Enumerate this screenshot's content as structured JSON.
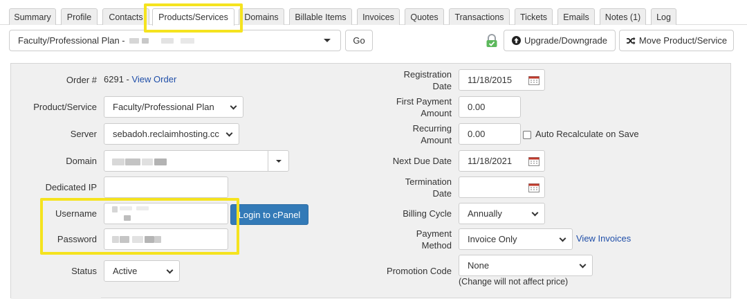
{
  "tabs": [
    {
      "label": "Summary",
      "active": false
    },
    {
      "label": "Profile",
      "active": false
    },
    {
      "label": "Contacts",
      "active": false
    },
    {
      "label": "Products/Services",
      "active": true
    },
    {
      "label": "Domains",
      "active": false
    },
    {
      "label": "Billable Items",
      "active": false
    },
    {
      "label": "Invoices",
      "active": false
    },
    {
      "label": "Quotes",
      "active": false
    },
    {
      "label": "Transactions",
      "active": false
    },
    {
      "label": "Tickets",
      "active": false
    },
    {
      "label": "Emails",
      "active": false
    },
    {
      "label": "Notes (1)",
      "active": false
    },
    {
      "label": "Log",
      "active": false
    }
  ],
  "toolbar": {
    "product_selected": "Faculty/Professional Plan -",
    "go_label": "Go",
    "upgrade_label": "Upgrade/Downgrade",
    "move_label": "Move Product/Service"
  },
  "left": {
    "order_label": "Order #",
    "order_number": "6291",
    "order_sep": " - ",
    "view_order_link": "View Order",
    "product_label": "Product/Service",
    "product_value": "Faculty/Professional Plan",
    "server_label": "Server",
    "server_value": "sebadoh.reclaimhosting.cc",
    "domain_label": "Domain",
    "dedicated_ip_label": "Dedicated IP",
    "dedicated_ip_value": "",
    "username_label": "Username",
    "login_cpanel_label": "Login to cPanel",
    "password_label": "Password",
    "status_label": "Status",
    "status_value": "Active"
  },
  "right": {
    "reg_date_label_1": "Registration",
    "reg_date_label_2": "Date",
    "reg_date_value": "11/18/2015",
    "first_payment_label_1": "First Payment",
    "first_payment_label_2": "Amount",
    "first_payment_value": "0.00",
    "recurring_label_1": "Recurring",
    "recurring_label_2": "Amount",
    "recurring_value": "0.00",
    "auto_recalc_label": "Auto Recalculate on Save",
    "next_due_label": "Next Due Date",
    "next_due_value": "11/18/2021",
    "termination_label_1": "Termination",
    "termination_label_2": "Date",
    "termination_value": "",
    "billing_cycle_label": "Billing Cycle",
    "billing_cycle_value": "Annually",
    "payment_method_label_1": "Payment",
    "payment_method_label_2": "Method",
    "payment_method_value": "Invoice Only",
    "view_invoices_link": "View Invoices",
    "promo_label": "Promotion Code",
    "promo_value": "None",
    "promo_note": "(Change will not affect price)"
  },
  "colors": {
    "highlight": "#f5e31f",
    "link": "#1f4ea8",
    "primary_button": "#337ab7",
    "lock_green": "#5cb85c"
  }
}
